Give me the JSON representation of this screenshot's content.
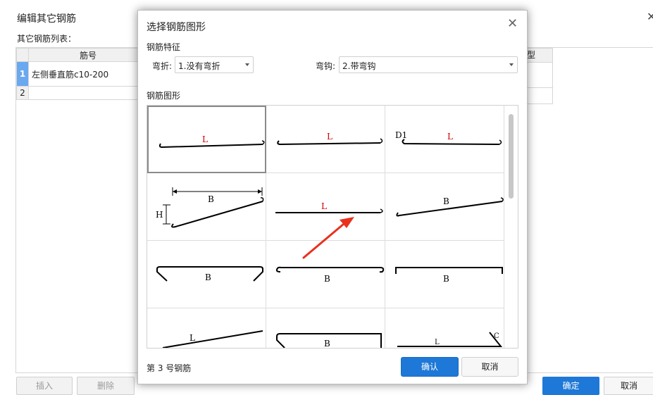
{
  "background": {
    "title": "编辑其它钢筋",
    "list_label": "其它钢筋列表：",
    "columns": {
      "name": "筋号",
      "partial_right": "型"
    },
    "rows": [
      {
        "index": "1",
        "name": "左侧垂直筋c10-200"
      },
      {
        "index": "2",
        "name": ""
      }
    ],
    "buttons": {
      "insert": "插入",
      "delete": "删除",
      "ok": "确定",
      "cancel": "取消"
    }
  },
  "dialog": {
    "title": "选择钢筋图形",
    "feature_section": "钢筋特征",
    "bend_label": "弯折:",
    "bend_value": "1.没有弯折",
    "hook_label": "弯钩:",
    "hook_value": "2.带弯钩",
    "shape_section": "钢筋图形",
    "status": "第 3 号钢筋",
    "confirm": "确认",
    "cancel": "取消",
    "shapes": [
      {
        "labels": [
          "L"
        ]
      },
      {
        "labels": [
          "L"
        ]
      },
      {
        "labels": [
          "D1",
          "L"
        ]
      },
      {
        "labels": [
          "B",
          "H"
        ]
      },
      {
        "labels": [
          "L"
        ]
      },
      {
        "labels": [
          "B"
        ]
      },
      {
        "labels": [
          "B"
        ]
      },
      {
        "labels": [
          "B"
        ]
      },
      {
        "labels": [
          "B"
        ]
      },
      {
        "labels": [
          "L"
        ]
      },
      {
        "labels": [
          "B"
        ]
      },
      {
        "labels": [
          "L",
          "C"
        ]
      }
    ]
  },
  "colors": {
    "primary": "#1e78d7",
    "label_red": "#d00000",
    "arrow": "#e8321e",
    "selected_row": "#6aa8ef"
  }
}
